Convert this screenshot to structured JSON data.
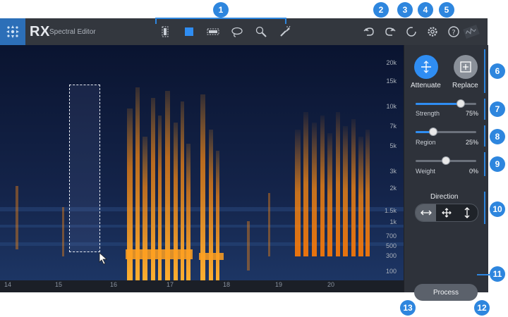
{
  "app": {
    "brand": "RX",
    "module": "Spectral Editor"
  },
  "toolbar": {
    "tools": [
      {
        "name": "time-selection-tool-icon"
      },
      {
        "name": "frequency-selection-tool-icon"
      },
      {
        "name": "time-frequency-selection-tool-icon"
      },
      {
        "name": "lasso-tool-icon"
      },
      {
        "name": "magic-wand-tool-icon"
      },
      {
        "name": "brush-tool-icon"
      }
    ],
    "actions": [
      "undo-icon",
      "redo-icon",
      "history-icon",
      "gear-icon",
      "help-icon"
    ]
  },
  "spectrogram": {
    "frequency_labels": [
      "20k",
      "15k",
      "10k",
      "7k",
      "5k",
      "3k",
      "2k",
      "1.5k",
      "1k",
      "700",
      "500",
      "300",
      "100"
    ],
    "time_labels": [
      "14",
      "15",
      "16",
      "17",
      "18",
      "19",
      "20"
    ]
  },
  "panel": {
    "modes": [
      {
        "label": "Attenuate",
        "selected": true
      },
      {
        "label": "Replace",
        "selected": false
      }
    ],
    "sliders": [
      {
        "label": "Strength",
        "value": "75%",
        "fraction": 0.75
      },
      {
        "label": "Region",
        "value": "25%",
        "fraction": 0.25
      },
      {
        "label": "Weight",
        "value": "0%",
        "fraction": 0.5
      }
    ],
    "direction": {
      "title": "Direction",
      "options": [
        "horizontal-arrows-icon",
        "all-directions-icon",
        "vertical-arrows-icon"
      ],
      "selected_index": 0
    },
    "process_label": "Process"
  },
  "callouts": [
    "1",
    "2",
    "3",
    "4",
    "5",
    "6",
    "7",
    "8",
    "9",
    "10",
    "11",
    "12",
    "13"
  ],
  "colors": {
    "accent": "#2f8df2",
    "callout": "#2e86de",
    "spectrum_hot": "#ff9a1a",
    "background_dark": "#0d1424"
  }
}
